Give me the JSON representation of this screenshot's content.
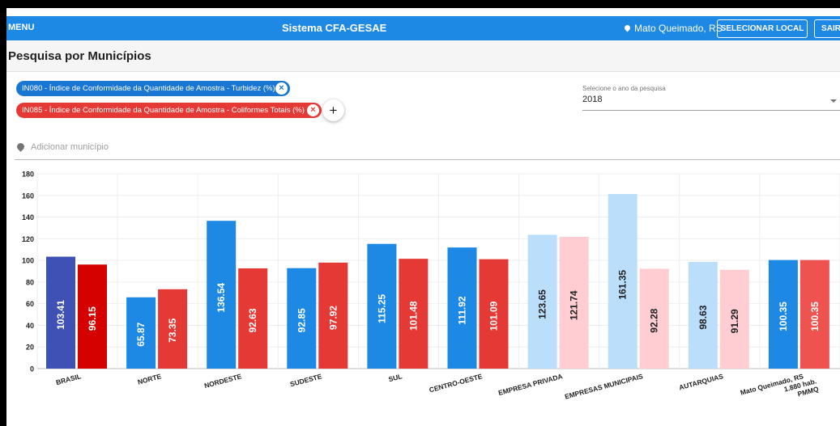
{
  "topbar": {
    "menu": "MENU",
    "title": "Sistema CFA-GESAE",
    "location": "Mato Queimado, RS",
    "select_location": "SELECIONAR LOCAL",
    "exit": "SAIR",
    "color": "#1e88e5"
  },
  "page": {
    "title": "Pesquisa por Municípios"
  },
  "indicators": [
    {
      "label": "IN080 - Índice de Conformidade da Quantidade de Amostra - Turbidez (%)",
      "color": "#1976d2"
    },
    {
      "label": "IN085 - Índice de Conformidade da Quantidade de Amostra - Coliformes Totais (%)",
      "color": "#e53935"
    }
  ],
  "add_indicator": "+",
  "year_select": {
    "label": "Selecione o ano da pesquisa",
    "value": "2018"
  },
  "municipality": {
    "placeholder": "Adicionar município"
  },
  "chart_data": {
    "type": "bar",
    "categories": [
      "BRASIL",
      "NORTE",
      "NORDESTE",
      "SUDESTE",
      "SUL",
      "CENTRO-OESTE",
      "EMPRESA PRIVADA",
      "EMPRESAS MUNICIPAIS",
      "AUTARQUIAS",
      "Mato Queimado, RS\n1.880 hab.\nPMMQ"
    ],
    "series": [
      {
        "values": [
          103.41,
          65.87,
          136.54,
          92.85,
          115.25,
          111.92,
          123.65,
          161.35,
          98.63,
          100.35
        ],
        "colors": [
          "#3f51b5",
          "#1e88e5",
          "#1e88e5",
          "#1e88e5",
          "#1e88e5",
          "#1e88e5",
          "#bbdefb",
          "#bbdefb",
          "#bbdefb",
          "#1e88e5"
        ]
      },
      {
        "values": [
          96.15,
          73.35,
          92.63,
          97.92,
          101.48,
          101.09,
          121.74,
          92.28,
          91.29,
          100.35
        ],
        "colors": [
          "#d50000",
          "#e53935",
          "#e53935",
          "#e53935",
          "#e53935",
          "#e53935",
          "#ffcdd2",
          "#ffcdd2",
          "#ffcdd2",
          "#ef5350"
        ]
      }
    ],
    "yticks": [
      0,
      20,
      40,
      60,
      80,
      100,
      120,
      140,
      160,
      180
    ],
    "ylim": [
      0,
      180
    ],
    "grid": true,
    "value_labels": "inside-rotated"
  }
}
